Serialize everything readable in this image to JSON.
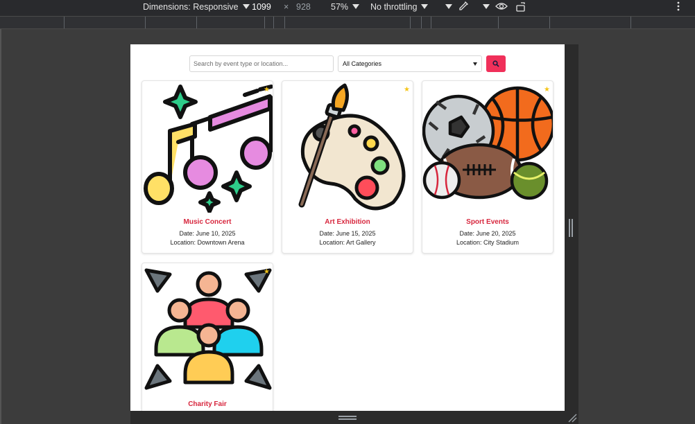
{
  "devtools": {
    "dimensions_label": "Dimensions: Responsive",
    "width": "1099",
    "times": "×",
    "height": "928",
    "zoom": "57%",
    "throttling": "No throttling"
  },
  "search": {
    "placeholder": "Search by event type or location...",
    "category_selected": "All Categories"
  },
  "events": [
    {
      "title": "Music Concert",
      "date": "Date: June 10, 2025",
      "location": "Location: Downtown Arena",
      "icon": "music-notes-icon"
    },
    {
      "title": "Art Exhibition",
      "date": "Date: June 15, 2025",
      "location": "Location: Art Gallery",
      "icon": "paint-palette-icon"
    },
    {
      "title": "Sport Events",
      "date": "Date: June 20, 2025",
      "location": "Location: City Stadium",
      "icon": "sports-balls-icon"
    },
    {
      "title": "Charity Fair",
      "date": "",
      "location": "",
      "icon": "people-community-icon"
    }
  ],
  "colors": {
    "accent": "#f0305a",
    "title_red": "#d7263d",
    "star": "#f5c518"
  }
}
